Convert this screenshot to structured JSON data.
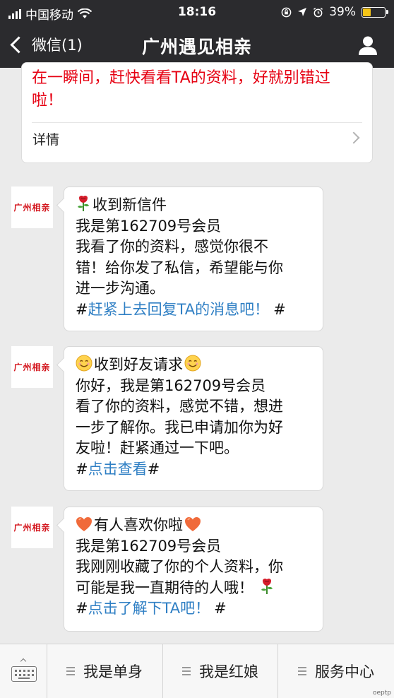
{
  "status_bar": {
    "carrier": "中国移动",
    "time": "18:16",
    "battery": "39%",
    "battery_level": 0.39
  },
  "nav": {
    "back_label": "微信(1)",
    "title": "广州遇见相亲"
  },
  "top_card": {
    "red_text_line1": "在一瞬间，赶快看看TA的资料，好就别错过",
    "red_text_line2": "啦！",
    "details_label": "详情"
  },
  "avatar_text": "广州相亲",
  "messages": [
    {
      "emoji": "rose",
      "heading": "收到新信件",
      "lines": [
        "我是第162709号会员",
        "我看了你的资料，感觉你很不",
        "错！给你发了私信，希望能与你",
        "进一步沟通。"
      ],
      "hash1": "#",
      "link": "赶紧上去回复TA的消息吧！",
      "hash2": "#"
    },
    {
      "emoji": "smile",
      "heading": "收到好友请求",
      "lines": [
        "你好，我是第162709号会员",
        "看了你的资料，感觉不错，想进",
        "一步了解你。我已申请加你为好",
        "友啦！赶紧通过一下吧。"
      ],
      "hash1": "#",
      "link": "点击查看",
      "hash2": "#"
    },
    {
      "emoji": "heart",
      "heading": "有人喜欢你啦",
      "lines": [
        "我是第162709号会员",
        "我刚刚收藏了你的个人资料，你",
        "可能是我一直期待的人哦！"
      ],
      "hash1": "#",
      "link": "点击了解下TA吧！",
      "hash2": "#"
    }
  ],
  "bottom_menu": {
    "items": [
      "我是单身",
      "我是红娘",
      "服务中心"
    ]
  },
  "watermark": "oeptp",
  "colors": {
    "bar_bg": "#2b2b2e",
    "red_text": "#e60012",
    "link": "#2f7fc4",
    "chat_bg": "#ebebeb"
  }
}
